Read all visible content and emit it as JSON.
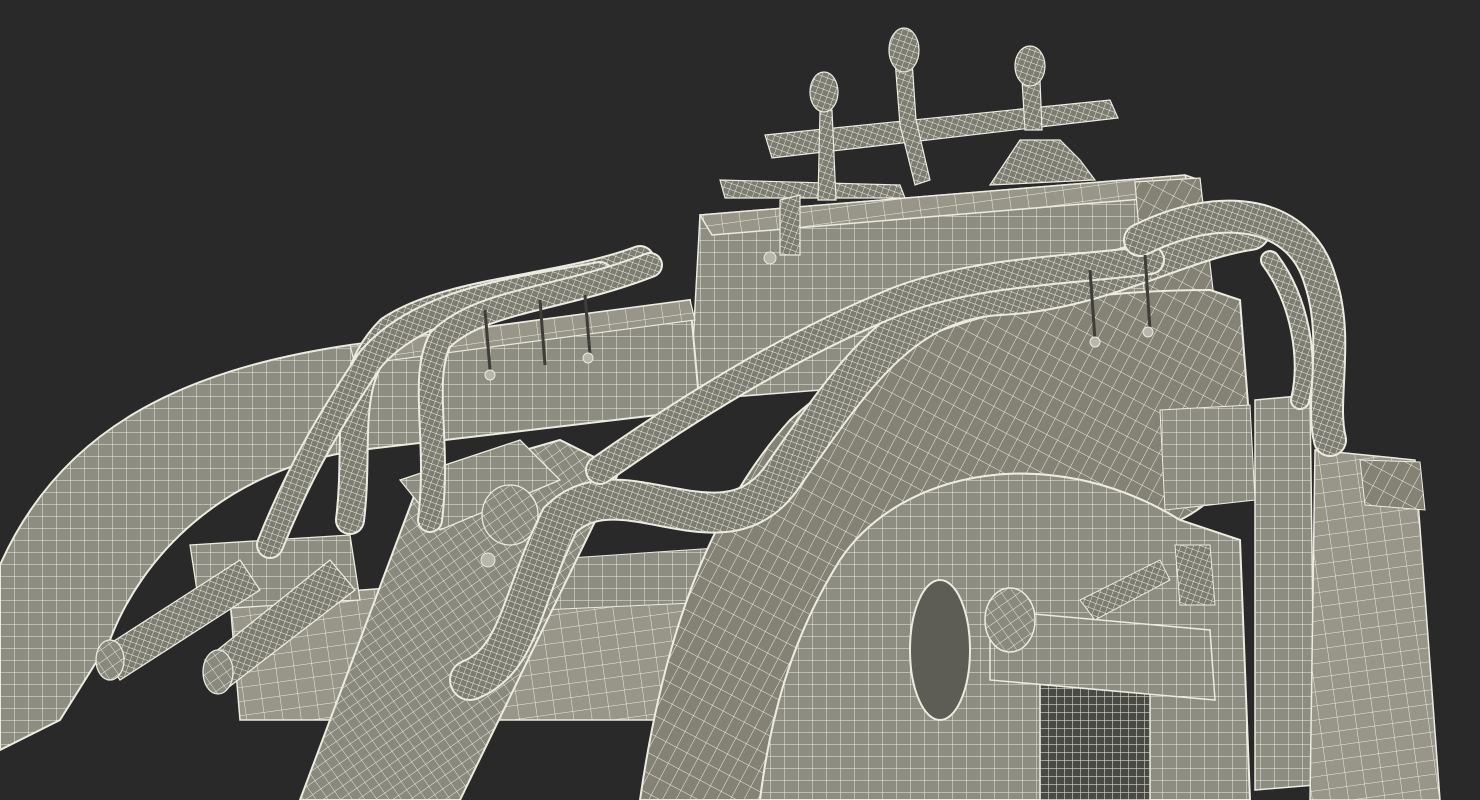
{
  "scene": {
    "subject": "wireframe-render-mini-skid-steer-loader",
    "colors": {
      "background": "#29292a",
      "surface": "#8e8d82",
      "surface_light": "#a9a89c",
      "surface_dark": "#6a695f",
      "wire": "#ecebe0",
      "hose": "#c9c8bb"
    }
  }
}
